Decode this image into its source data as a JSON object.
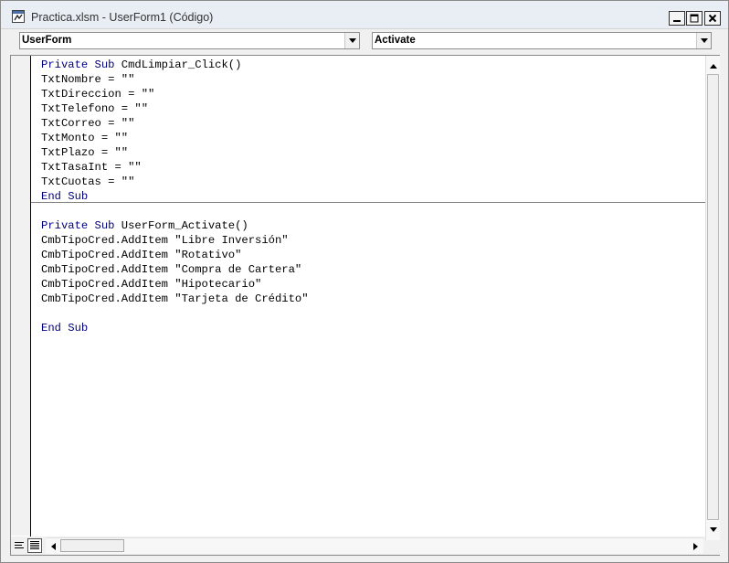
{
  "window": {
    "title": "Practica.xlsm - UserForm1 (Código)"
  },
  "object_combo": {
    "value": "UserForm"
  },
  "procedure_combo": {
    "value": "Activate"
  },
  "code_lines": [
    [
      {
        "t": "Private Sub ",
        "k": true
      },
      {
        "t": "CmdLimpiar_Click()",
        "k": false
      }
    ],
    [
      {
        "t": "TxtNombre = \"\"",
        "k": false
      }
    ],
    [
      {
        "t": "TxtDireccion = \"\"",
        "k": false
      }
    ],
    [
      {
        "t": "TxtTelefono = \"\"",
        "k": false
      }
    ],
    [
      {
        "t": "TxtCorreo = \"\"",
        "k": false
      }
    ],
    [
      {
        "t": "TxtMonto = \"\"",
        "k": false
      }
    ],
    [
      {
        "t": "TxtPlazo = \"\"",
        "k": false
      }
    ],
    [
      {
        "t": "TxtTasaInt = \"\"",
        "k": false
      }
    ],
    [
      {
        "t": "TxtCuotas = \"\"",
        "k": false
      }
    ],
    [
      {
        "t": "End Sub",
        "k": true
      }
    ],
    [],
    [
      {
        "t": "Private Sub ",
        "k": true
      },
      {
        "t": "UserForm_Activate()",
        "k": false
      }
    ],
    [
      {
        "t": "CmbTipoCred.AddItem \"Libre Inversión\"",
        "k": false
      }
    ],
    [
      {
        "t": "CmbTipoCred.AddItem \"Rotativo\"",
        "k": false
      }
    ],
    [
      {
        "t": "CmbTipoCred.AddItem \"Compra de Cartera\"",
        "k": false
      }
    ],
    [
      {
        "t": "CmbTipoCred.AddItem \"Hipotecario\"",
        "k": false
      }
    ],
    [
      {
        "t": "CmbTipoCred.AddItem \"Tarjeta de Crédito\"",
        "k": false
      }
    ],
    [],
    [
      {
        "t": "End Sub",
        "k": true
      }
    ]
  ],
  "colors": {
    "keyword": "#00007f",
    "text": "#000000",
    "separator": "#808080"
  },
  "icons": {
    "title": "vba-code-window-icon",
    "minimize": "minimize-icon",
    "restore": "restore-icon",
    "close": "close-icon",
    "dropdown": "chevron-down-icon",
    "procedure_view": "procedure-view-icon",
    "full_module_view": "full-module-view-icon"
  }
}
